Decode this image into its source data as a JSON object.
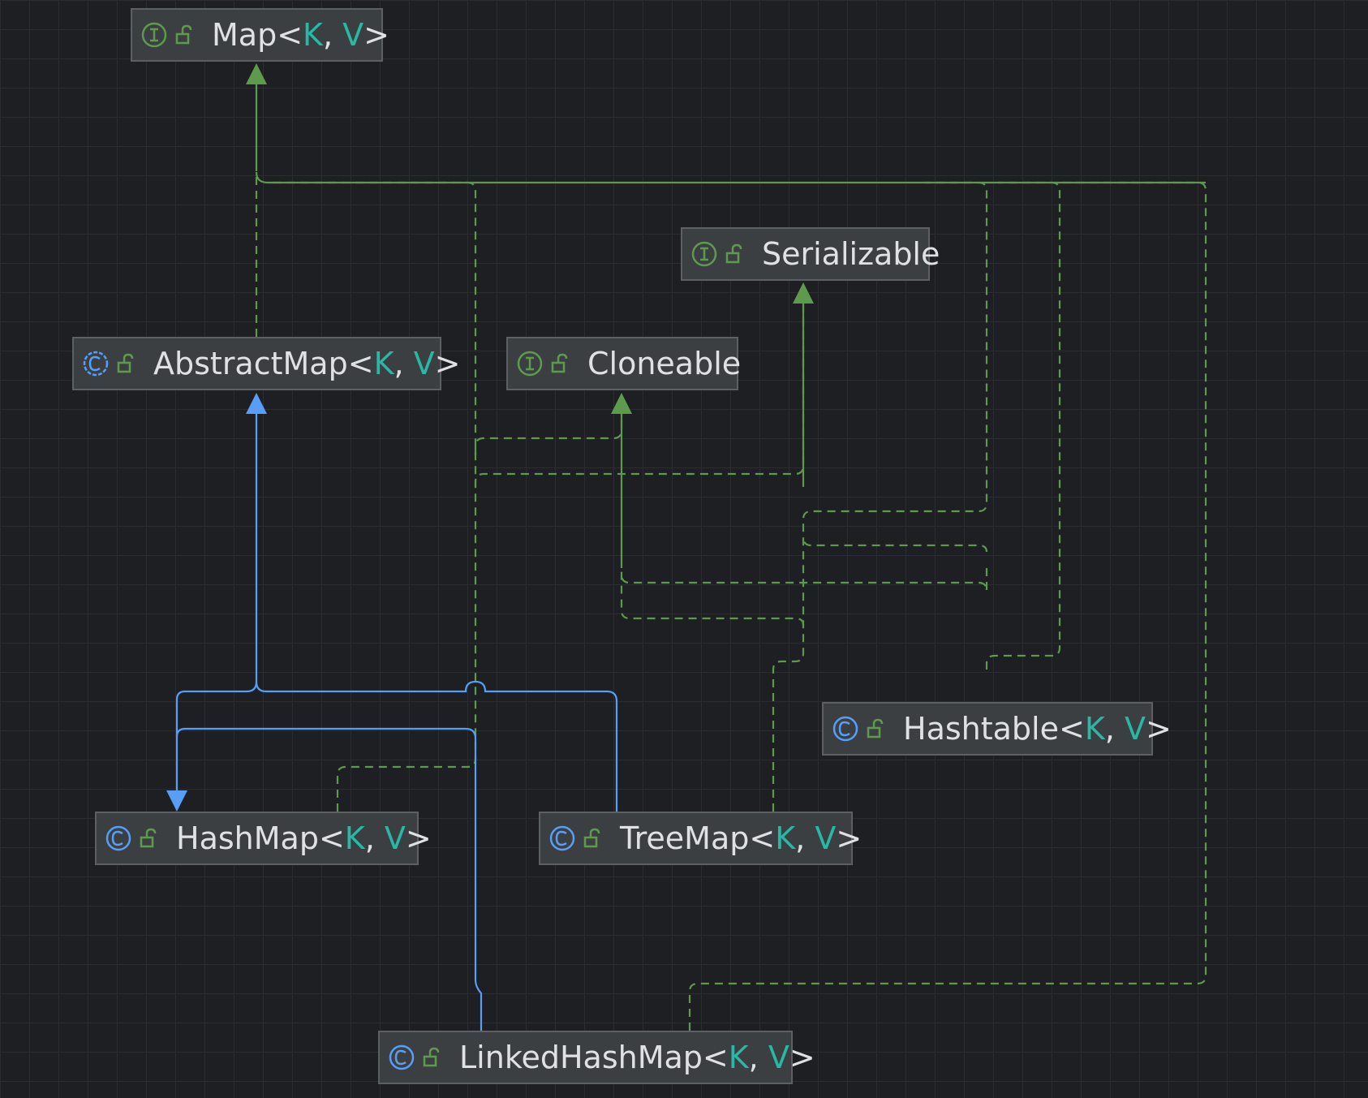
{
  "nodes": {
    "map": {
      "kind": "interface",
      "name": "Map",
      "type_params": [
        "K",
        "V"
      ]
    },
    "serializable": {
      "kind": "interface",
      "name": "Serializable",
      "type_params": []
    },
    "abstract_map": {
      "kind": "class",
      "name": "AbstractMap",
      "type_params": [
        "K",
        "V"
      ]
    },
    "cloneable": {
      "kind": "interface",
      "name": "Cloneable",
      "type_params": []
    },
    "hashtable": {
      "kind": "class",
      "name": "Hashtable",
      "type_params": [
        "K",
        "V"
      ]
    },
    "hash_map": {
      "kind": "class",
      "name": "HashMap",
      "type_params": [
        "K",
        "V"
      ]
    },
    "tree_map": {
      "kind": "class",
      "name": "TreeMap",
      "type_params": [
        "K",
        "V"
      ]
    },
    "linked_hash_map": {
      "kind": "class",
      "name": "LinkedHashMap",
      "type_params": [
        "K",
        "V"
      ]
    }
  },
  "edges": [
    {
      "from": "abstract_map",
      "to": "map",
      "relation": "implements"
    },
    {
      "from": "hashtable",
      "to": "map",
      "relation": "implements"
    },
    {
      "from": "hash_map",
      "to": "map",
      "relation": "implements"
    },
    {
      "from": "tree_map",
      "to": "map",
      "relation": "implements"
    },
    {
      "from": "linked_hash_map",
      "to": "map",
      "relation": "implements"
    },
    {
      "from": "hash_map",
      "to": "abstract_map",
      "relation": "extends"
    },
    {
      "from": "tree_map",
      "to": "abstract_map",
      "relation": "extends"
    },
    {
      "from": "linked_hash_map",
      "to": "hash_map",
      "relation": "extends"
    },
    {
      "from": "hash_map",
      "to": "cloneable",
      "relation": "implements"
    },
    {
      "from": "hash_map",
      "to": "serializable",
      "relation": "implements"
    },
    {
      "from": "tree_map",
      "to": "cloneable",
      "relation": "implements"
    },
    {
      "from": "tree_map",
      "to": "serializable",
      "relation": "implements"
    },
    {
      "from": "hashtable",
      "to": "cloneable",
      "relation": "implements"
    },
    {
      "from": "hashtable",
      "to": "serializable",
      "relation": "implements"
    }
  ],
  "colors": {
    "background": "#1e1f22",
    "grid": "#2b2d30",
    "node_fill": "#3c3f41",
    "node_border": "#5c5f63",
    "text": "#dfe1e5",
    "type_param": "#29b8a6",
    "implements_edge": "#5e9a4e",
    "extends_edge": "#589df6",
    "interface_icon": "#5e9a4e",
    "class_icon": "#589df6"
  },
  "icons": {
    "interface": "interface-icon",
    "class": "class-icon",
    "visibility": "public-lock-icon"
  }
}
